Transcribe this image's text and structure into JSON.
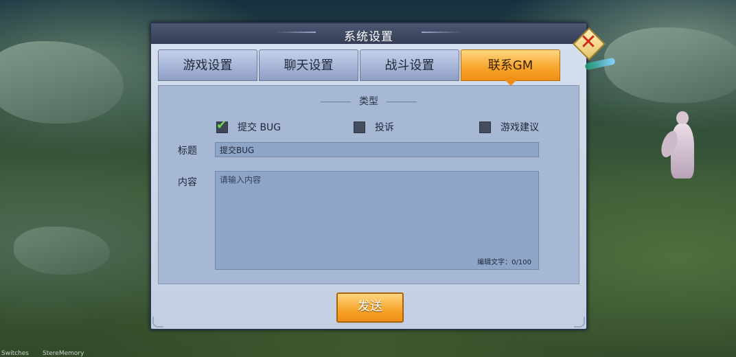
{
  "dialog": {
    "title": "系统设置"
  },
  "tabs": [
    {
      "label": "游戏设置",
      "active": false
    },
    {
      "label": "聊天设置",
      "active": false
    },
    {
      "label": "战斗设置",
      "active": false
    },
    {
      "label": "联系GM",
      "active": true
    }
  ],
  "form": {
    "type_label": "类型",
    "options": [
      {
        "label": "提交 BUG",
        "checked": true
      },
      {
        "label": "投诉",
        "checked": false
      },
      {
        "label": "游戏建议",
        "checked": false
      }
    ],
    "title_label": "标题",
    "title_value": "提交BUG",
    "content_label": "内容",
    "content_placeholder": "请输入内容",
    "counter": "编辑文字：0/100"
  },
  "send_label": "发送",
  "bottom_texts": [
    "Switches",
    "StereMemory"
  ],
  "colors": {
    "accent": "#f7a42a",
    "panel": "#a7b8d4",
    "check": "#6fd84a",
    "close": "#cf2a1a"
  }
}
